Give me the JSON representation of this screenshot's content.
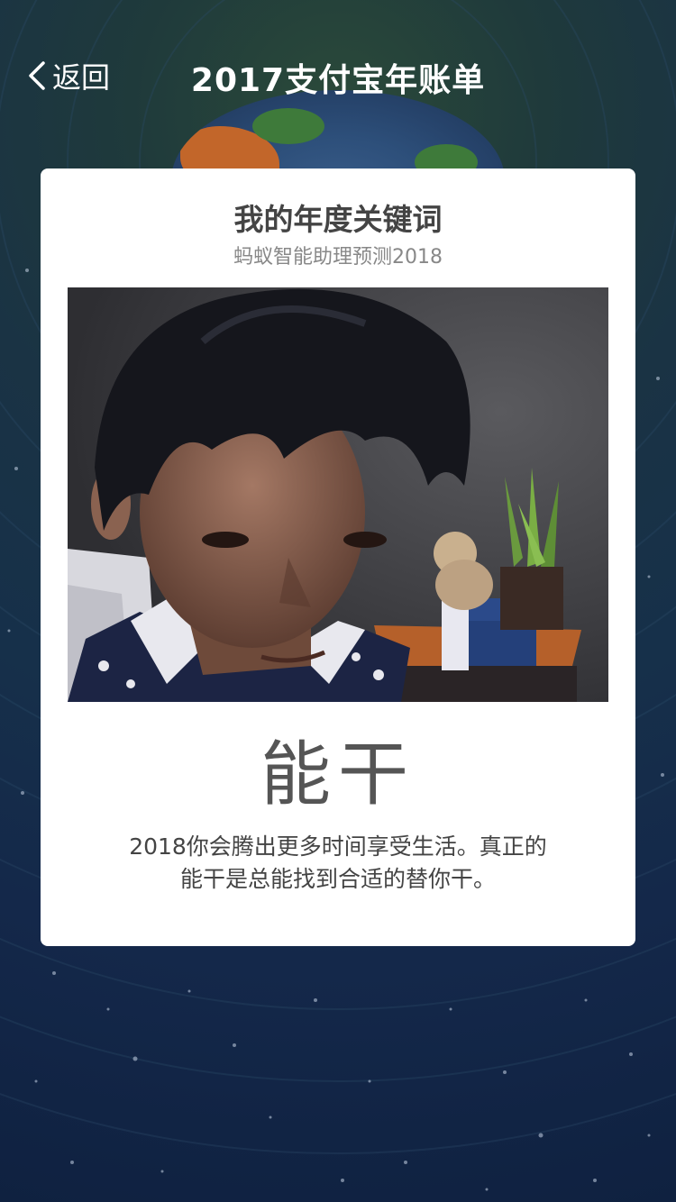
{
  "nav": {
    "back_label": "返回",
    "title": "2017支付宝年账单"
  },
  "card": {
    "title": "我的年度关键词",
    "subtitle": "蚂蚁智能助理预测2018",
    "keyword": "能干",
    "description_line1": "2018你会腾出更多时间享受生活。真正的",
    "description_line2": "能干是总能找到合适的替你干。"
  },
  "colors": {
    "background": "#16304a",
    "card": "#ffffff",
    "title_text": "#444444",
    "subtitle_text": "#888888"
  }
}
